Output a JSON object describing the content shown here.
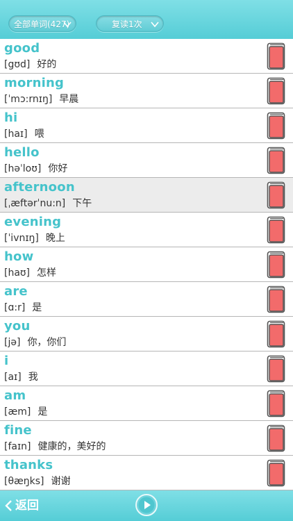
{
  "header": {
    "filter_label": "全部单词(427)",
    "review_label": "复读1次"
  },
  "words": [
    {
      "word": "good",
      "phonetic": "[gʊd]",
      "meaning": "好的"
    },
    {
      "word": "morning",
      "phonetic": "[ˈmɔ:rnɪŋ]",
      "meaning": "早晨"
    },
    {
      "word": "hi",
      "phonetic": "[haɪ]",
      "meaning": "喂"
    },
    {
      "word": "hello",
      "phonetic": "[həˈloʊ]",
      "meaning": "你好"
    },
    {
      "word": "afternoon",
      "phonetic": "[ˌæftərˈnu:n]",
      "meaning": "下午"
    },
    {
      "word": "evening",
      "phonetic": "[ˈivnɪŋ]",
      "meaning": "晚上"
    },
    {
      "word": "how",
      "phonetic": "[haʊ]",
      "meaning": "怎样"
    },
    {
      "word": "are",
      "phonetic": "[ɑ:r]",
      "meaning": "是"
    },
    {
      "word": "you",
      "phonetic": "[jə]",
      "meaning": "你，你们"
    },
    {
      "word": "i",
      "phonetic": "[aɪ]",
      "meaning": "我"
    },
    {
      "word": "am",
      "phonetic": "[æm]",
      "meaning": "是"
    },
    {
      "word": "fine",
      "phonetic": "[faɪn]",
      "meaning": "健康的，美好的"
    },
    {
      "word": "thanks",
      "phonetic": "[θæŋks]",
      "meaning": "谢谢"
    }
  ],
  "footer": {
    "back_label": "返回"
  },
  "colors": {
    "accent": "#55cdd6",
    "word": "#45c3cb",
    "book": "#f26b6b"
  }
}
